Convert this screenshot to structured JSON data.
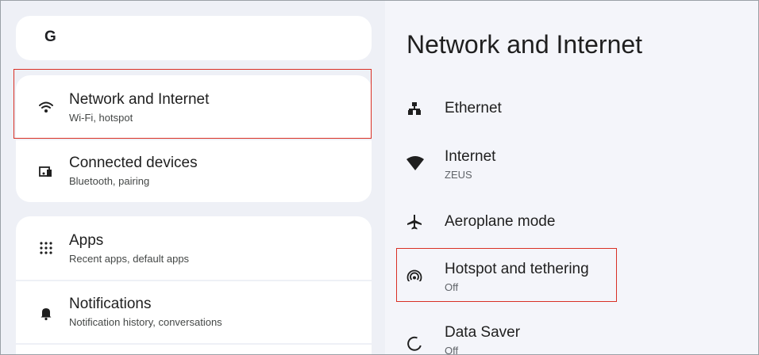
{
  "search": {
    "logo_text": "G"
  },
  "sidebar": {
    "items": [
      {
        "title": "Network and Internet",
        "subtitle": "Wi-Fi, hotspot",
        "icon": "wifi-icon"
      },
      {
        "title": "Connected devices",
        "subtitle": "Bluetooth, pairing",
        "icon": "devices-icon"
      },
      {
        "title": "Apps",
        "subtitle": "Recent apps, default apps",
        "icon": "apps-grid-icon"
      },
      {
        "title": "Notifications",
        "subtitle": "Notification history, conversations",
        "icon": "bell-icon"
      }
    ]
  },
  "main": {
    "title": "Network and Internet",
    "items": [
      {
        "title": "Ethernet",
        "subtitle": "",
        "icon": "ethernet-icon"
      },
      {
        "title": "Internet",
        "subtitle": "ZEUS",
        "icon": "wifi-signal-icon"
      },
      {
        "title": "Aeroplane mode",
        "subtitle": "",
        "icon": "airplane-icon"
      },
      {
        "title": "Hotspot and tethering",
        "subtitle": "Off",
        "icon": "hotspot-icon"
      },
      {
        "title": "Data Saver",
        "subtitle": "Off",
        "icon": "data-saver-icon"
      }
    ]
  },
  "colors": {
    "highlight": "#d93025",
    "sidebar_bg": "#eef0f6",
    "main_bg": "#f4f5fa"
  }
}
